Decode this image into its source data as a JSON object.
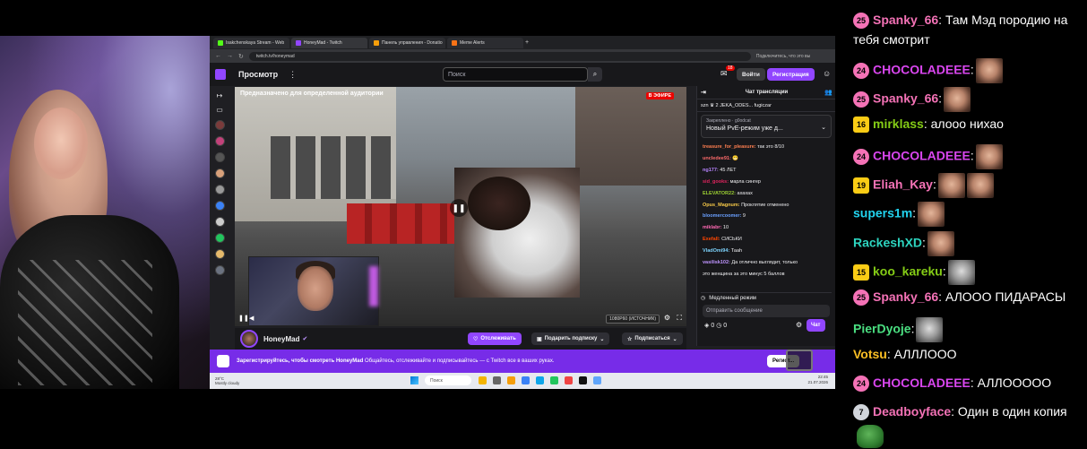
{
  "browser": {
    "tabs": [
      {
        "label": "Isakchenskaya Stream - Web"
      },
      {
        "label": "HoneyMad - Twitch"
      },
      {
        "label": "Панель управления - Donatio"
      },
      {
        "label": "Meme Alerts"
      }
    ],
    "url": "twitch.tv/honeymad",
    "toolbar_right": "Подключитесь, что это вы"
  },
  "twitch": {
    "browse_label": "Просмотр",
    "search_placeholder": "Поиск",
    "notif_count": "18",
    "login_label": "Войти",
    "signup_label": "Регистрация",
    "audience_label": "Предназначено для определенной аудитории",
    "live_label": "В ЭФИРЕ",
    "quality_label": "1080P60 (ИСТОЧНИК)",
    "channel_name": "HoneyMad",
    "follow_label": "Отслеживать",
    "gift_label": "Подарить подписку",
    "subscribe_label": "Подписаться",
    "chat_title": "Чат трансляции",
    "gift_row": "szn ♛ 2   JEKA_ODES...   fugiczar",
    "pinned_by": "Закреплено · g0odcat",
    "pinned_text": "Новый PvE-режим уже д...",
    "slow_mode": "Медленный режим",
    "send_placeholder": "Отправить сообщение",
    "points": "0",
    "points2": "0",
    "chat_button": "Чат",
    "banner_text_bold": "Зарегистрируйтесь, чтобы смотреть HoneyMad",
    "banner_text": " Общайтесь, отслеживайте и подписывайтесь — с Twitch все в ваших руках.",
    "banner_button": "Регист...",
    "messages": [
      {
        "user": "treasure_for_pleasure:",
        "text": " так это 8/10",
        "color": "#ff7f50"
      },
      {
        "user": "uncledee91:",
        "text": " 😬",
        "color": "#ff6b6b"
      },
      {
        "user": "ng177:",
        "text": " 45 ЛЕТ",
        "color": "#b784ff"
      },
      {
        "user": "sid_gooks:",
        "text": " марла сингер",
        "color": "#e0245e"
      },
      {
        "user": "ELEVATOR22:",
        "text": " ахахах",
        "color": "#9acd32"
      },
      {
        "user": "Opus_Magnum:",
        "text": " Проклятие отменено",
        "color": "#f7c948"
      },
      {
        "user": "bloomercoomer:",
        "text": " 9",
        "color": "#6aa0ff"
      },
      {
        "user": "miklabr:",
        "text": " 10",
        "color": "#ff69b4"
      },
      {
        "user": "Exefall:",
        "text": " СИСЬКИ",
        "color": "#ff4500"
      },
      {
        "user": "VladOmi94:",
        "text": " Таah",
        "color": "#7dd3fc"
      },
      {
        "user": "vasilisk102:",
        "text": " Да отлично выглядит, только",
        "color": "#bf94ff"
      },
      {
        "user": "",
        "text": "это женщина за это минус 5 баллов",
        "color": "#efeff1"
      }
    ]
  },
  "taskbar": {
    "weather_temp": "28°C",
    "weather_desc": "Mostly cloudy",
    "search_placeholder": "Поиск",
    "time": "22:45",
    "date": "21.07.2026"
  },
  "overlay_chat": [
    {
      "badge": "25",
      "badge_type": "circ",
      "badge_color": "#f472b6",
      "name": "Spanky_66",
      "name_color": "#f472b6",
      "text": ": Там Мэд породию на",
      "line2": "тебя смотрит",
      "emotes": 0
    },
    {
      "badge": "24",
      "badge_type": "circ",
      "badge_color": "#f472b6",
      "name": "CHOCOLADEEE",
      "name_color": "#d946ef",
      "text": ":",
      "emotes": 1
    },
    {
      "badge": "25",
      "badge_type": "circ",
      "badge_color": "#f472b6",
      "name": "Spanky_66",
      "name_color": "#f472b6",
      "text": ":",
      "emotes": 1
    },
    {
      "badge": "16",
      "badge_type": "sq",
      "badge_color": "#facc15",
      "name": "mirklass",
      "name_color": "#84cc16",
      "text": ": алоoo нихао",
      "emotes": 0
    },
    {
      "badge": "24",
      "badge_type": "circ",
      "badge_color": "#f472b6",
      "name": "CHOCOLADEEE",
      "name_color": "#d946ef",
      "text": ":",
      "emotes": 1
    },
    {
      "badge": "19",
      "badge_type": "sq",
      "badge_color": "#facc15",
      "name": "Eliah_Kay",
      "name_color": "#f472b6",
      "text": ":",
      "emotes": 2
    },
    {
      "badge": "",
      "badge_type": "none",
      "badge_color": "",
      "name": "supers1m",
      "name_color": "#22d3ee",
      "text": ":",
      "emotes": 1
    },
    {
      "badge": "",
      "badge_type": "none",
      "badge_color": "",
      "name": "RackeshXD",
      "name_color": "#2dd4bf",
      "text": ":",
      "emotes": 1
    },
    {
      "badge": "15",
      "badge_type": "sq",
      "badge_color": "#facc15",
      "name": "koo_kareku",
      "name_color": "#84cc16",
      "text": ":",
      "emotes": 1,
      "emote_style": "gray"
    },
    {
      "badge": "25",
      "badge_type": "circ",
      "badge_color": "#f472b6",
      "name": "Spanky_66",
      "name_color": "#f472b6",
      "text": ": АЛООО ПИДАРАСЫ",
      "emotes": 0
    },
    {
      "badge": "",
      "badge_type": "none",
      "badge_color": "",
      "name": "PierDyoje",
      "name_color": "#4ade80",
      "text": ":",
      "emotes": 1,
      "emote_style": "gray"
    },
    {
      "badge": "",
      "badge_type": "none",
      "badge_color": "",
      "name": "Votsu",
      "name_color": "#fbbf24",
      "text": ": АЛЛЛООО",
      "emotes": 0
    },
    {
      "badge": "24",
      "badge_type": "circ",
      "badge_color": "#f472b6",
      "name": "CHOCOLADEEE",
      "name_color": "#d946ef",
      "text": ": АЛЛООООО",
      "emotes": 0
    },
    {
      "badge": "7",
      "badge_type": "circ",
      "badge_color": "#d1d5db",
      "name": "Deadboyface",
      "name_color": "#f472b6",
      "text": ": Один в один копия",
      "emotes": 0,
      "frog": true
    }
  ]
}
